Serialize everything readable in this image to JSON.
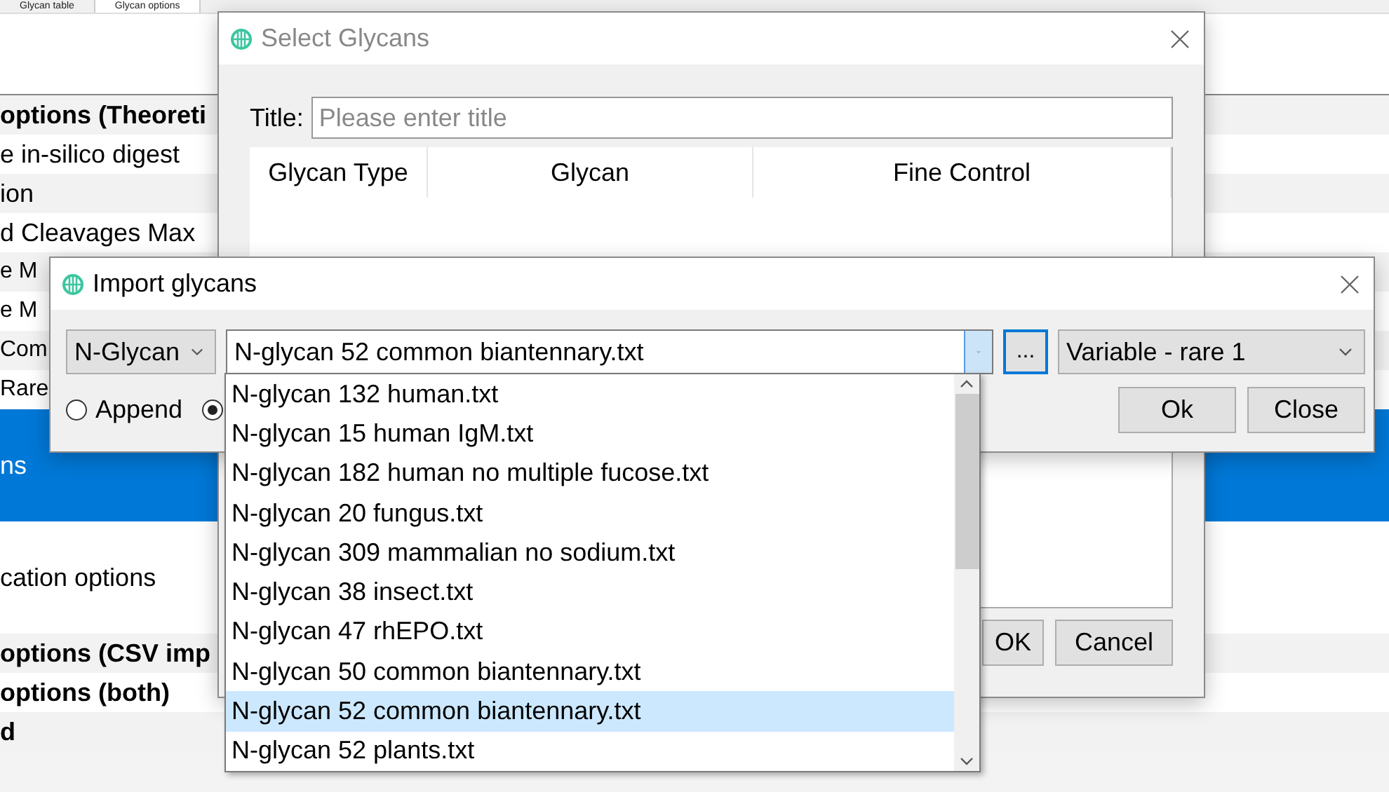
{
  "app_tabs": [
    {
      "label": "Glycan table",
      "selected": false
    },
    {
      "label": "Glycan options",
      "selected": true
    }
  ],
  "option_list": [
    {
      "label": "options (Theoreti",
      "kind": "header",
      "selected": false
    },
    {
      "label": "e in-silico digest",
      "kind": "item",
      "selected": false
    },
    {
      "label": "ion",
      "kind": "item",
      "selected": false
    },
    {
      "label": "d Cleavages Max",
      "kind": "item",
      "selected": false
    },
    {
      "label": "e M",
      "kind": "item",
      "selected": false
    },
    {
      "label": "e M",
      "kind": "item",
      "selected": false
    },
    {
      "label": "Com",
      "kind": "item",
      "selected": false
    },
    {
      "label": "Rare",
      "kind": "item",
      "selected": false
    },
    {
      "label": "ns",
      "kind": "section",
      "selected": true
    },
    {
      "label": "cation options",
      "kind": "section",
      "selected": false
    },
    {
      "label": "options (CSV imp",
      "kind": "header",
      "selected": false
    },
    {
      "label": "options (both)",
      "kind": "header",
      "selected": false
    },
    {
      "label": "d",
      "kind": "header",
      "selected": false
    }
  ],
  "select_dialog": {
    "title": "Select Glycans",
    "title_field": {
      "label": "Title:",
      "placeholder": "Please enter title"
    },
    "columns": [
      "Glycan Type",
      "Glycan",
      "Fine Control"
    ],
    "buttons": [
      "OK",
      "Cancel"
    ]
  },
  "import_dialog": {
    "title": "Import glycans",
    "glycan_type": "N-Glycan",
    "file": "N-glycan 52 common biantennary.txt",
    "browse": "...",
    "modification": "Variable - rare 1",
    "modes": [
      {
        "label": "Append",
        "selected": false
      },
      {
        "selected": true
      }
    ],
    "buttons": [
      "Ok",
      "Close"
    ],
    "file_options": [
      {
        "label": "N-glycan 132 human.txt",
        "selected": false
      },
      {
        "label": "N-glycan 15 human IgM.txt",
        "selected": false
      },
      {
        "label": "N-glycan 182 human no multiple fucose.txt",
        "selected": false
      },
      {
        "label": "N-glycan 20 fungus.txt",
        "selected": false
      },
      {
        "label": "N-glycan 309 mammalian no sodium.txt",
        "selected": false
      },
      {
        "label": "N-glycan 38 insect.txt",
        "selected": false
      },
      {
        "label": "N-glycan 47 rhEPO.txt",
        "selected": false
      },
      {
        "label": "N-glycan 50 common biantennary.txt",
        "selected": false
      },
      {
        "label": "N-glycan 52 common biantennary.txt",
        "selected": true
      },
      {
        "label": "N-glycan 52 plants.txt",
        "selected": false
      }
    ]
  }
}
